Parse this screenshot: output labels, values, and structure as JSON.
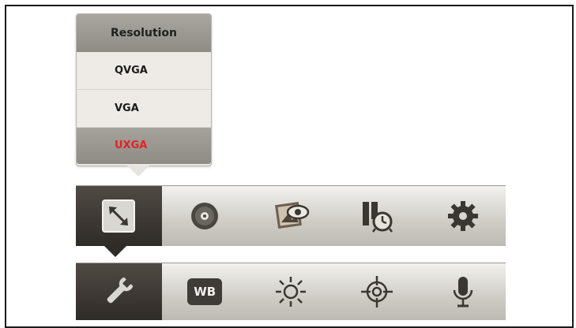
{
  "popup": {
    "title": "Resolution",
    "options": [
      "QVGA",
      "VGA",
      "UXGA"
    ],
    "selected": "UXGA"
  },
  "toolbar_top": {
    "items": [
      "resize-icon",
      "disc-icon",
      "image-view-icon",
      "timer-icon",
      "gear-icon"
    ],
    "active_index": 0
  },
  "toolbar_bottom": {
    "items": [
      "wrench-icon",
      "white-balance-icon",
      "brightness-icon",
      "target-icon",
      "microphone-icon"
    ],
    "active_index": 0,
    "wb_label": "WB"
  },
  "colors": {
    "selected_text": "#e0222a",
    "active_bg": "#2f2b27"
  }
}
